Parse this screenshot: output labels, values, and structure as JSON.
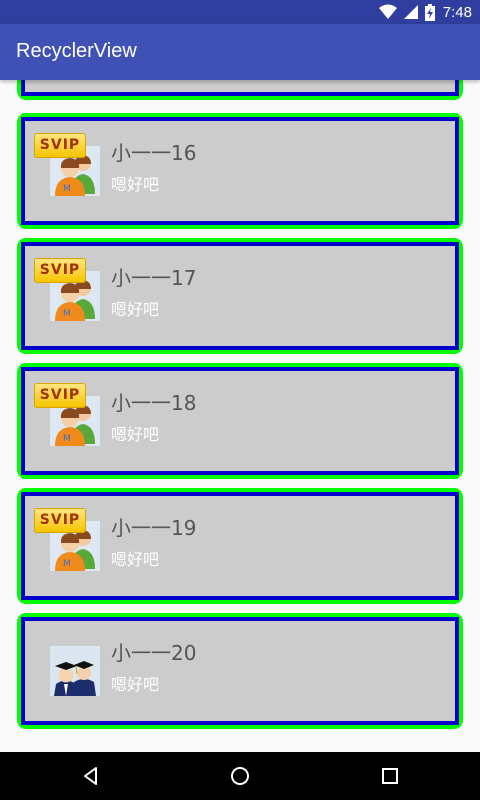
{
  "status_bar": {
    "time": "7:48"
  },
  "app_bar": {
    "title": "RecyclerView"
  },
  "items": [
    {
      "name": "小一一16",
      "message": "嗯好吧",
      "vip": "SVIP",
      "avatar": "two-users-icon"
    },
    {
      "name": "小一一17",
      "message": "嗯好吧",
      "vip": "SVIP",
      "avatar": "two-users-icon"
    },
    {
      "name": "小一一18",
      "message": "嗯好吧",
      "vip": "SVIP",
      "avatar": "two-users-icon"
    },
    {
      "name": "小一一19",
      "message": "嗯好吧",
      "vip": "SVIP",
      "avatar": "two-users-icon"
    },
    {
      "name": "小一一20",
      "message": "嗯好吧",
      "avatar": "graduates-icon"
    }
  ],
  "colors": {
    "status_bar": "#303f9f",
    "app_bar": "#3f51b5",
    "card_outer": "#00ff00",
    "card_inner": "#0000cc",
    "card_fill": "#cccccc"
  }
}
